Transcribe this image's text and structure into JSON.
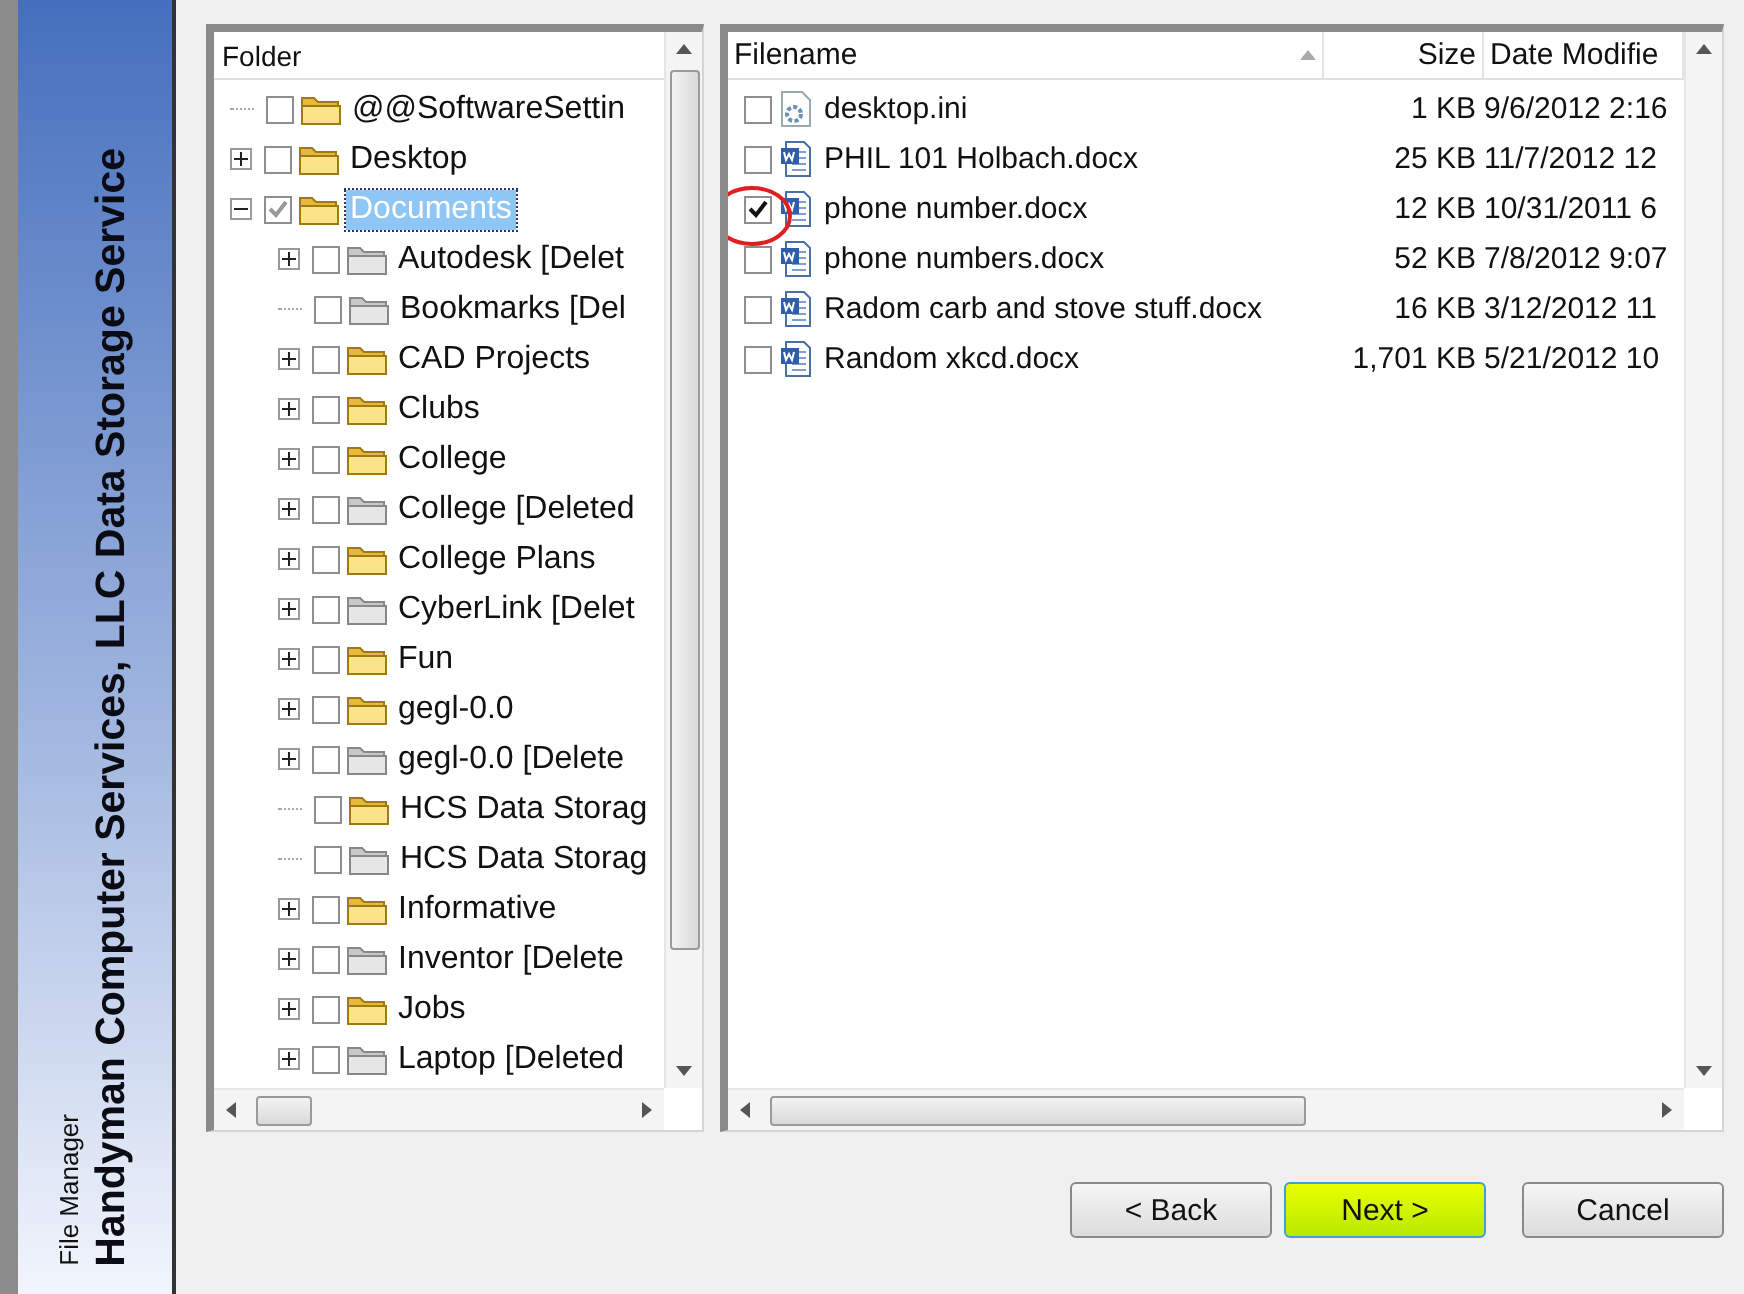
{
  "sidebar": {
    "title": "Handyman Computer Services, LLC Data Storage Service",
    "subtitle": "File Manager"
  },
  "folder_tree": {
    "header": "Folder",
    "items": [
      {
        "label": "@@SoftwareSettin",
        "checked": false,
        "faded": false,
        "selected": false
      },
      {
        "label": "Desktop",
        "checked": false,
        "faded": false,
        "selected": false,
        "expanded": false
      },
      {
        "label": "Documents",
        "checked": true,
        "faded": false,
        "selected": true,
        "expanded": true,
        "children": [
          {
            "label": "Autodesk [Delet",
            "checked": false,
            "faded": true,
            "selected": false,
            "expanded": false
          },
          {
            "label": "Bookmarks [Del",
            "checked": false,
            "faded": true,
            "selected": false
          },
          {
            "label": "CAD Projects",
            "checked": false,
            "faded": false,
            "selected": false,
            "expanded": false
          },
          {
            "label": "Clubs",
            "checked": false,
            "faded": false,
            "selected": false,
            "expanded": false
          },
          {
            "label": "College",
            "checked": false,
            "faded": false,
            "selected": false,
            "expanded": false
          },
          {
            "label": "College [Deleted",
            "checked": false,
            "faded": true,
            "selected": false,
            "expanded": false
          },
          {
            "label": "College Plans",
            "checked": false,
            "faded": false,
            "selected": false,
            "expanded": false
          },
          {
            "label": "CyberLink [Delet",
            "checked": false,
            "faded": true,
            "selected": false,
            "expanded": false
          },
          {
            "label": "Fun",
            "checked": false,
            "faded": false,
            "selected": false,
            "expanded": false
          },
          {
            "label": "gegl-0.0",
            "checked": false,
            "faded": false,
            "selected": false,
            "expanded": false
          },
          {
            "label": "gegl-0.0 [Delete",
            "checked": false,
            "faded": true,
            "selected": false,
            "expanded": false
          },
          {
            "label": "HCS Data Storag",
            "checked": false,
            "faded": false,
            "selected": false
          },
          {
            "label": "HCS Data Storag",
            "checked": false,
            "faded": true,
            "selected": false
          },
          {
            "label": "Informative",
            "checked": false,
            "faded": false,
            "selected": false,
            "expanded": false
          },
          {
            "label": "Inventor [Delete",
            "checked": false,
            "faded": true,
            "selected": false,
            "expanded": false
          },
          {
            "label": "Jobs",
            "checked": false,
            "faded": false,
            "selected": false,
            "expanded": false
          },
          {
            "label": "Laptop [Deleted",
            "checked": false,
            "faded": true,
            "selected": false,
            "expanded": false
          }
        ]
      }
    ]
  },
  "file_list": {
    "columns": [
      "Filename",
      "Size",
      "Date Modifie"
    ],
    "rows": [
      {
        "kind": "ini",
        "name": "desktop.ini",
        "size": "1 KB",
        "date": "9/6/2012 2:16",
        "checked": false
      },
      {
        "kind": "docx",
        "name": "PHIL 101 Holbach.docx",
        "size": "25 KB",
        "date": "11/7/2012 12",
        "checked": false
      },
      {
        "kind": "docx",
        "name": "phone number.docx",
        "size": "12 KB",
        "date": "10/31/2011 6",
        "checked": true
      },
      {
        "kind": "docx",
        "name": "phone numbers.docx",
        "size": "52 KB",
        "date": "7/8/2012 9:07",
        "checked": false
      },
      {
        "kind": "docx",
        "name": "Radom carb and stove stuff.docx",
        "size": "16 KB",
        "date": "3/12/2012 11",
        "checked": false
      },
      {
        "kind": "docx",
        "name": "Random xkcd.docx",
        "size": "1,701 KB",
        "date": "5/21/2012 10",
        "checked": false
      }
    ]
  },
  "buttons": [
    {
      "label": "< Back",
      "highlighted": false
    },
    {
      "label": "Next >",
      "highlighted": true
    },
    {
      "label": "Cancel",
      "highlighted": false
    }
  ]
}
